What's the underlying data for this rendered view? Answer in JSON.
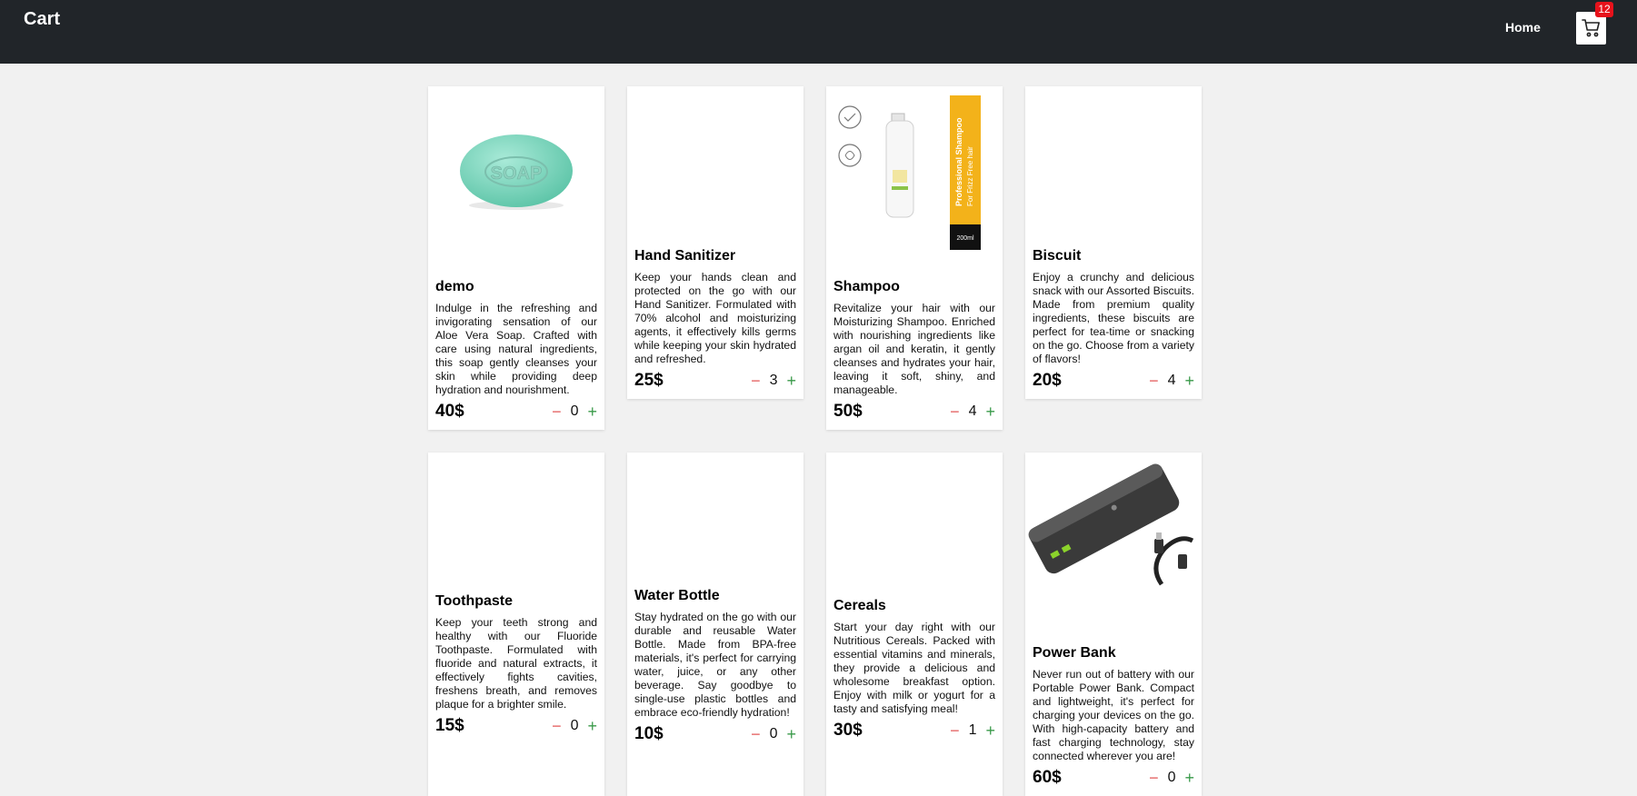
{
  "navbar": {
    "brand": "Cart",
    "home_label": "Home",
    "cart_icon": "shopping-cart-icon",
    "cart_count": "12",
    "background": "#212529",
    "badge_color": "#e7121b"
  },
  "products": [
    {
      "title": "demo",
      "desc": "Indulge in the refreshing and invigorating sensation of our Aloe Vera Soap. Crafted with care using natural ingredients, this soap gently cleanses your skin while providing deep hydration and nourishment.",
      "price": "40$",
      "qty": "0",
      "image": "soap"
    },
    {
      "title": "Hand Sanitizer",
      "desc": "Keep your hands clean and protected on the go with our Hand Sanitizer. Formulated with 70% alcohol and moisturizing agents, it effectively kills germs while keeping your skin hydrated and refreshed.",
      "price": "25$",
      "qty": "3",
      "image": ""
    },
    {
      "title": "Shampoo",
      "desc": "Revitalize your hair with our Moisturizing Shampoo. Enriched with nourishing ingredients like argan oil and keratin, it gently cleanses and hydrates your hair, leaving it soft, shiny, and manageable.",
      "price": "50$",
      "qty": "4",
      "image": "shampoo"
    },
    {
      "title": "Biscuit",
      "desc": "Enjoy a crunchy and delicious snack with our Assorted Biscuits. Made from premium quality ingredients, these biscuits are perfect for tea-time or snacking on the go. Choose from a variety of flavors!",
      "price": "20$",
      "qty": "4",
      "image": ""
    },
    {
      "title": "Toothpaste",
      "desc": "Keep your teeth strong and healthy with our Fluoride Toothpaste. Formulated with fluoride and natural extracts, it effectively fights cavities, freshens breath, and removes plaque for a brighter smile.",
      "price": "15$",
      "qty": "0",
      "image": ""
    },
    {
      "title": "Water Bottle",
      "desc": "Stay hydrated on the go with our durable and reusable Water Bottle. Made from BPA-free materials, it's perfect for carrying water, juice, or any other beverage. Say goodbye to single-use plastic bottles and embrace eco-friendly hydration!",
      "price": "10$",
      "qty": "0",
      "image": ""
    },
    {
      "title": "Cereals",
      "desc": "Start your day right with our Nutritious Cereals. Packed with essential vitamins and minerals, they provide a delicious and wholesome breakfast option. Enjoy with milk or yogurt for a tasty and satisfying meal!",
      "price": "30$",
      "qty": "1",
      "image": ""
    },
    {
      "title": "Power Bank",
      "desc": "Never run out of battery with our Portable Power Bank. Compact and lightweight, it's perfect for charging your devices on the go. With high-capacity battery and fast charging technology, stay connected wherever you are!",
      "price": "60$",
      "qty": "0",
      "image": "powerbank"
    }
  ],
  "controls": {
    "minus_symbol": "−",
    "plus_symbol": "+"
  },
  "shampoo_label": {
    "line1": "Professional Shampoo",
    "line2": "For Frizz Free hair",
    "volume": "200ml"
  },
  "soap_label": "SOAP"
}
